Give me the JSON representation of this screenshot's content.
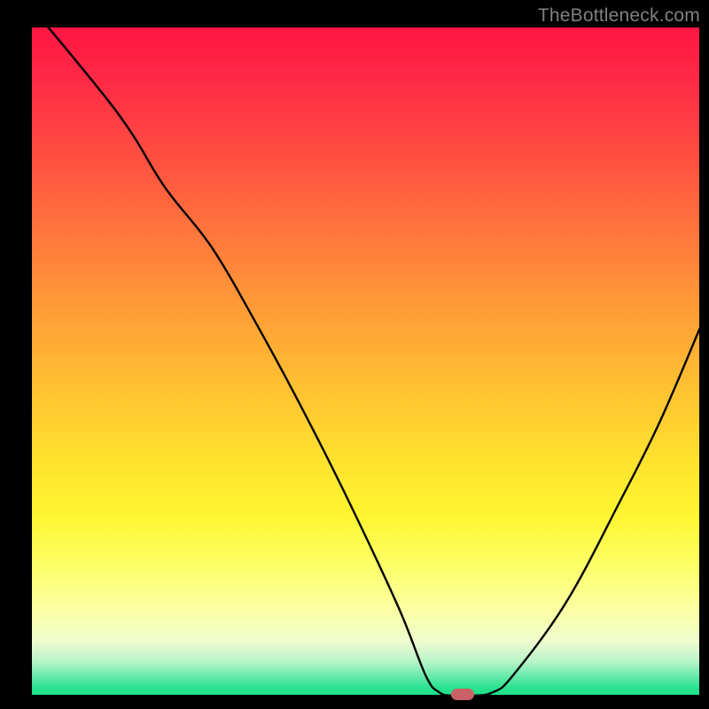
{
  "watermark": "TheBottleneck.com",
  "colors": {
    "frame": "#000000",
    "gradient_top": "#ff1644",
    "gradient_mid": "#ffe22e",
    "gradient_bottom": "#1ee08a",
    "curve": "#000000",
    "marker": "#c96167",
    "watermark_text": "#808080"
  },
  "chart_data": {
    "type": "line",
    "title": "",
    "xlabel": "",
    "ylabel": "",
    "xlim": [
      0,
      100
    ],
    "ylim": [
      0,
      100
    ],
    "series": [
      {
        "name": "bottleneck-curve",
        "x": [
          0,
          13,
          20,
          27,
          34,
          41,
          48,
          55,
          59,
          61,
          63,
          66,
          69,
          72,
          80,
          88,
          94,
          100
        ],
        "y": [
          103,
          87,
          76,
          67,
          55,
          42,
          28,
          13,
          3,
          0.5,
          0,
          0,
          0.5,
          3,
          14,
          29,
          41,
          55
        ]
      }
    ],
    "marker": {
      "x": 64.5,
      "y": 0,
      "shape": "pill"
    },
    "background": "vertical-gradient red→yellow→green (heat scale)"
  }
}
